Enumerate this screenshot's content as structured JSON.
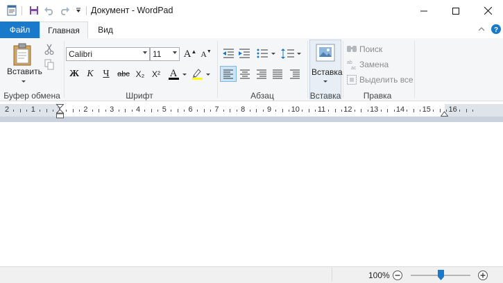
{
  "window": {
    "title": "Документ - WordPad",
    "controls": [
      "minimize",
      "maximize",
      "close"
    ]
  },
  "quick_access": [
    "wordpad-app-icon",
    "save-icon",
    "undo-icon",
    "redo-icon",
    "customize-icon"
  ],
  "tabs": [
    {
      "label": "Файл",
      "active": false,
      "accent": "#1979ca"
    },
    {
      "label": "Главная",
      "active": true
    },
    {
      "label": "Вид",
      "active": false
    }
  ],
  "groups": {
    "clipboard": {
      "label": "Буфер обмена",
      "paste_label": "Вставить"
    },
    "font": {
      "label": "Шрифт",
      "font_name": "Calibri",
      "font_size": "11"
    },
    "paragraph": {
      "label": "Абзац"
    },
    "insert": {
      "label": "Вставка"
    },
    "editing": {
      "label": "Правка",
      "find": "Поиск",
      "replace": "Замена",
      "select_all": "Выделить все"
    }
  },
  "font_buttons": {
    "bold": "Ж",
    "italic": "К",
    "underline": "Ч",
    "strike": "abc",
    "subscript": "X₂",
    "superscript": "X²",
    "grow": "A",
    "shrink": "A"
  },
  "ruler": {
    "labels": [
      "2",
      "1",
      "1",
      "2",
      "3",
      "4",
      "5",
      "6",
      "7",
      "8",
      "9",
      "10",
      "11",
      "12",
      "13",
      "14",
      "15",
      "16"
    ]
  },
  "status": {
    "zoom": "100%"
  },
  "colors": {
    "accent": "#1979ca",
    "ribbon_bg": "#f5f6f7",
    "font_color_bar": "#000000",
    "highlight_bar": "#ffff00"
  }
}
